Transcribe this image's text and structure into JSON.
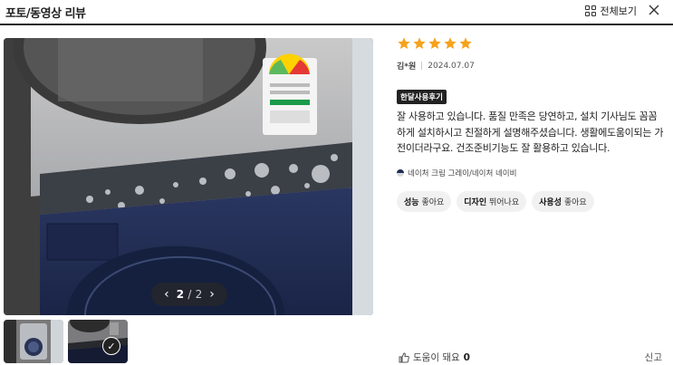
{
  "header": {
    "title": "포토/동영상 리뷰",
    "view_all_label": "전체보기"
  },
  "gallery": {
    "current": "2",
    "total": "2",
    "thumbnail_count": 2,
    "selected_thumbnail": 2
  },
  "review": {
    "rating": 5,
    "user": "김*원",
    "date": "2024.07.07",
    "badge": "한달사용후기",
    "text": "잘 사용하고 있습니다. 품질 만족은 당연하고, 설치 기사님도 꼼꼼하게 설치하시고 친절하게 설명해주셨습니다. 생활에도움이되는 가전이더라구요. 건조준비기능도 잘 활용하고 있습니다.",
    "option": "네이처 크림 그레이/네이처 네이비",
    "tags": [
      {
        "category": "성능",
        "value": "좋아요"
      },
      {
        "category": "디자인",
        "value": "뛰어나요"
      },
      {
        "category": "사용성",
        "value": "좋아요"
      }
    ]
  },
  "footer": {
    "helpful_label": "도움이 돼요",
    "helpful_count": "0",
    "report_label": "신고"
  },
  "colors": {
    "star": "#f7a21b",
    "badge_bg": "#222222",
    "navy": "#1f2d55"
  }
}
